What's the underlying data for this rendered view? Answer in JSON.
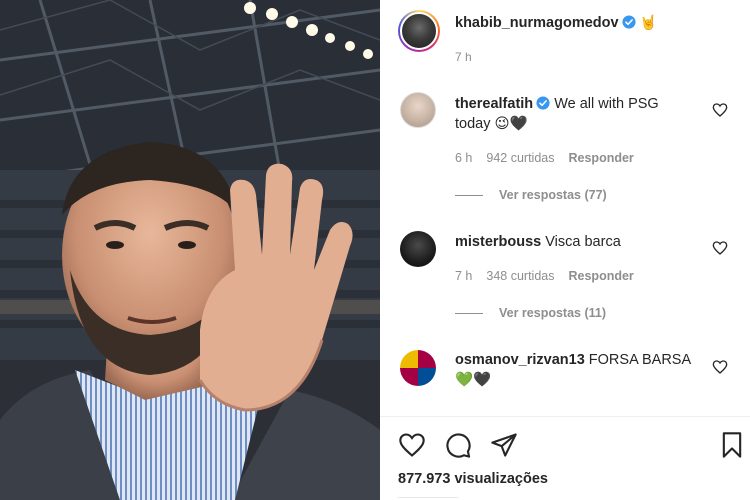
{
  "post": {
    "owner": "khabib_nurmagomedov",
    "owner_emoji": "🤘",
    "time": "7 h",
    "views": "877.973 visualizações"
  },
  "comments": [
    {
      "user": "therealfatih",
      "text": "We all with PSG today 😉🖤",
      "verified": true,
      "time": "6 h",
      "likes": "942 curtidas",
      "reply_label": "Responder",
      "view_replies": "Ver respostas (77)"
    },
    {
      "user": "misterbouss",
      "text": "Visca barca",
      "verified": false,
      "time": "7 h",
      "likes": "348 curtidas",
      "reply_label": "Responder",
      "view_replies": "Ver respostas (11)"
    },
    {
      "user": "osmanov_rizvan13",
      "text": "FORSA BARSA 💚🖤",
      "verified": false
    }
  ],
  "icons": {
    "like": "heart-icon",
    "comment": "comment-icon",
    "share": "share-icon",
    "save": "bookmark-icon",
    "verified": "verified-badge-icon"
  },
  "colors": {
    "verified": "#3897f0",
    "text": "#262626",
    "muted": "#8e8e8e"
  }
}
